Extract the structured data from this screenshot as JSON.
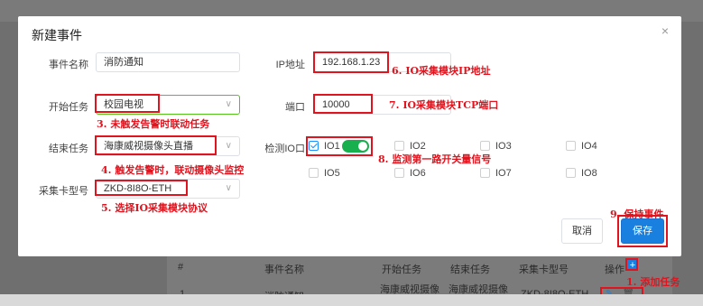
{
  "background": {
    "table_headers": [
      "#",
      "事件名称",
      "开始任务",
      "结束任务",
      "采集卡型号",
      "操作"
    ],
    "row": {
      "index": "1",
      "name": "消防通知",
      "start_task": "海康威视摄像",
      "end_task": "海康威视摄像",
      "card_model": "ZKD-8I8O-ETH"
    }
  },
  "modal": {
    "title": "新建事件",
    "close_label": "×",
    "event_name_label": "事件名称",
    "event_name_value": "消防通知",
    "start_task_label": "开始任务",
    "start_task_value": "校园电视",
    "end_task_label": "结束任务",
    "end_task_value": "海康威视摄像头直播",
    "card_model_label": "采集卡型号",
    "card_model_value": "ZKD-8I8O-ETH",
    "ip_label": "IP地址",
    "ip_value": "192.168.1.23",
    "port_label": "端口",
    "port_value": "10000",
    "io_label": "检测IO口",
    "io_items": [
      "IO1",
      "IO2",
      "IO3",
      "IO4",
      "IO5",
      "IO6",
      "IO7",
      "IO8"
    ],
    "io1_enabled": true,
    "cancel_label": "取消",
    "save_label": "保存"
  },
  "annotations": {
    "a1": "1. 添加任务",
    "a3": "3. 未触发告警时联动任务",
    "a4": "4. 触发告警时，联动摄像头监控",
    "a5": "5. 选择IO采集模块协议",
    "a6": "6. IO采集模块IP地址",
    "a7": "7. IO采集模块TCP端口",
    "a8": "8. 监测第一路开关量信号",
    "a9": "9. 保持事件"
  },
  "colors": {
    "annotation_red": "#e0141e",
    "primary_blue": "#1a80e0",
    "toggle_green": "#18b04e"
  }
}
